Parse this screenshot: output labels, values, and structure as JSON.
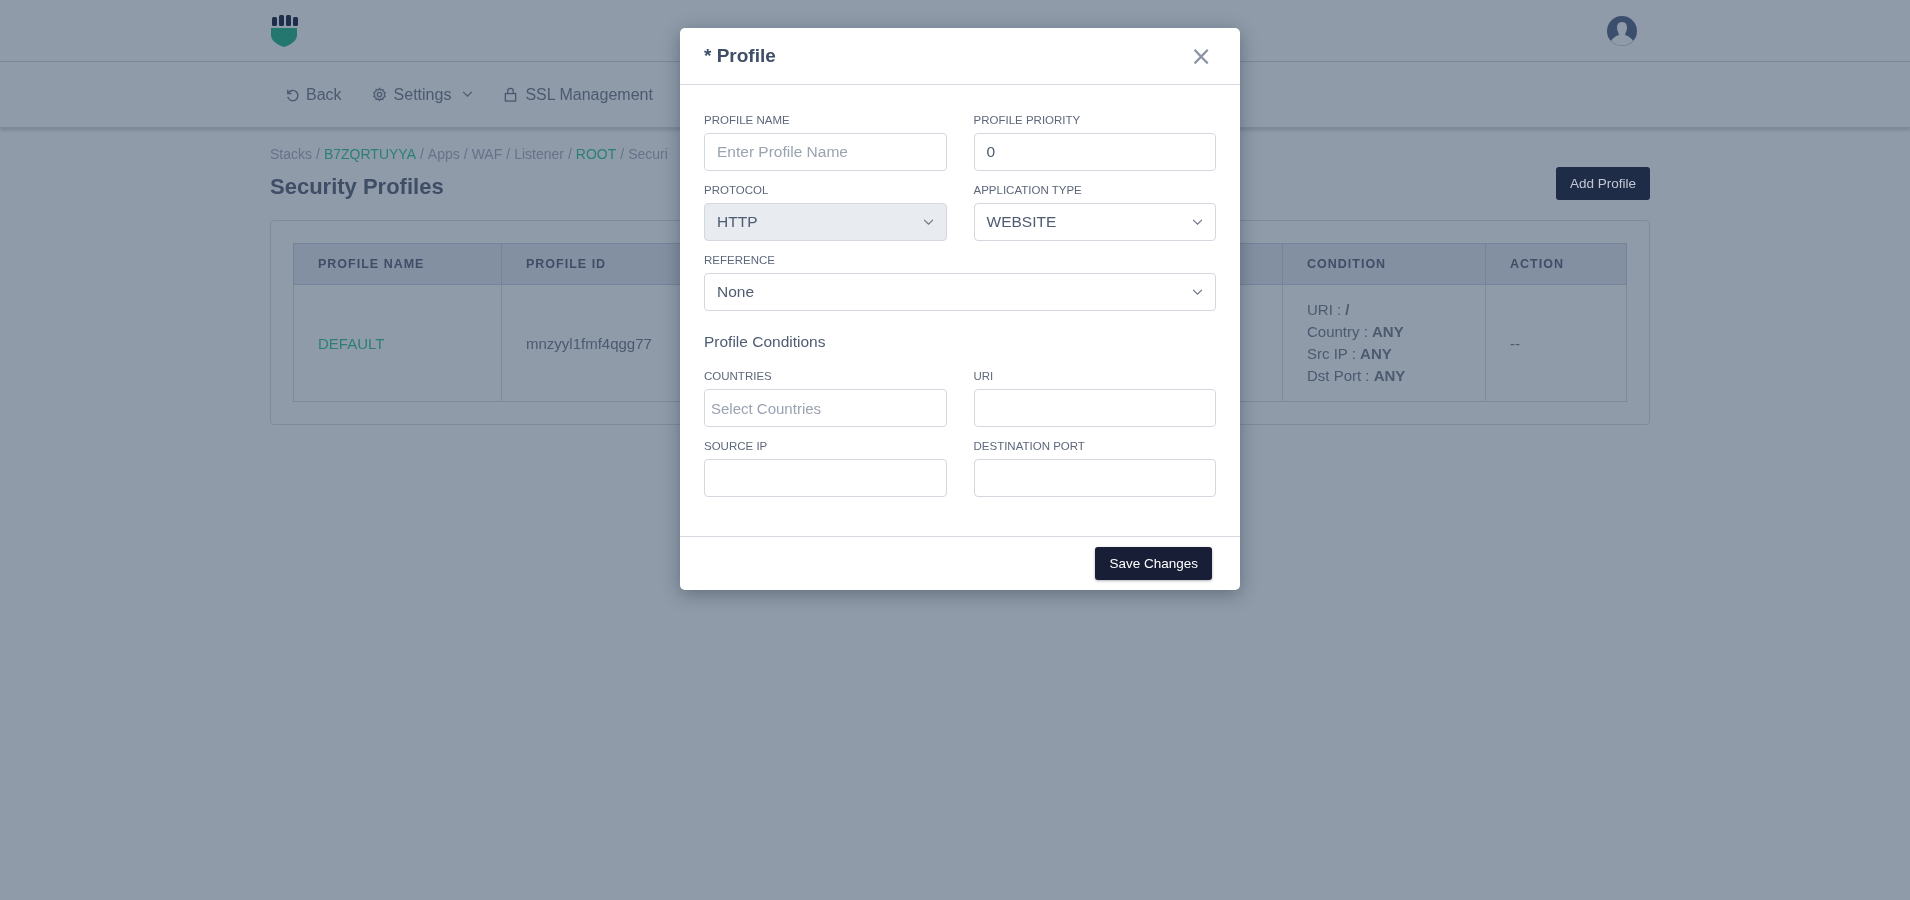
{
  "nav": [
    {
      "label": "Back",
      "dropdown": false
    },
    {
      "label": "Settings",
      "dropdown": true
    },
    {
      "label": "SSL Management",
      "dropdown": false
    }
  ],
  "breadcrumb": {
    "separator": "/",
    "items": [
      {
        "text": "Stacks",
        "link": false
      },
      {
        "text": "B7ZQRTUYYA",
        "link": true
      },
      {
        "text": "Apps",
        "link": false
      },
      {
        "text": "WAF",
        "link": false
      },
      {
        "text": "Listener",
        "link": false
      },
      {
        "text": "ROOT",
        "link": true
      },
      {
        "text": "Securi",
        "link": false
      }
    ]
  },
  "page_title": "Security Profiles",
  "add_button": "Add Profile",
  "table": {
    "columns": [
      "PROFILE NAME",
      "PROFILE ID",
      "CONDITION",
      "ACTION"
    ],
    "rows": [
      {
        "profile_name": "DEFAULT",
        "profile_id": "mnzyyl1fmf4qgg77",
        "condition": [
          "URI : **/**",
          "Country : **ANY**",
          "Src IP : **ANY**",
          "Dst Port : **ANY**"
        ],
        "action": "--"
      }
    ]
  },
  "modal": {
    "title": "* Profile",
    "close": "×",
    "rows": [
      [
        {
          "kind": "input",
          "label": "PROFILE NAME",
          "placeholder": "Enter Profile Name",
          "disabled": false
        },
        {
          "kind": "input",
          "label": "PROFILE PRIORITY",
          "value": "0",
          "disabled": false
        }
      ],
      [
        {
          "kind": "select",
          "label": "PROTOCOL",
          "value": "HTTP",
          "disabled": true
        },
        {
          "kind": "select",
          "label": "APPLICATION TYPE",
          "value": "WEBSITE",
          "disabled": false
        }
      ],
      [
        {
          "kind": "select",
          "label": "REFERENCE",
          "value": "None",
          "disabled": false
        }
      ]
    ],
    "section_title": "Profile Conditions",
    "condition_rows": [
      [
        {
          "kind": "input",
          "label": "COUNTRIES",
          "placeholder": "Select Countries",
          "disabled": false
        },
        {
          "kind": "input",
          "label": "URI",
          "disabled": false
        }
      ],
      [
        {
          "kind": "input",
          "label": "SOURCE IP",
          "disabled": false
        },
        {
          "kind": "input",
          "label": "DESTINATION PORT",
          "disabled": false
        }
      ]
    ],
    "save_button": "Save Changes"
  }
}
